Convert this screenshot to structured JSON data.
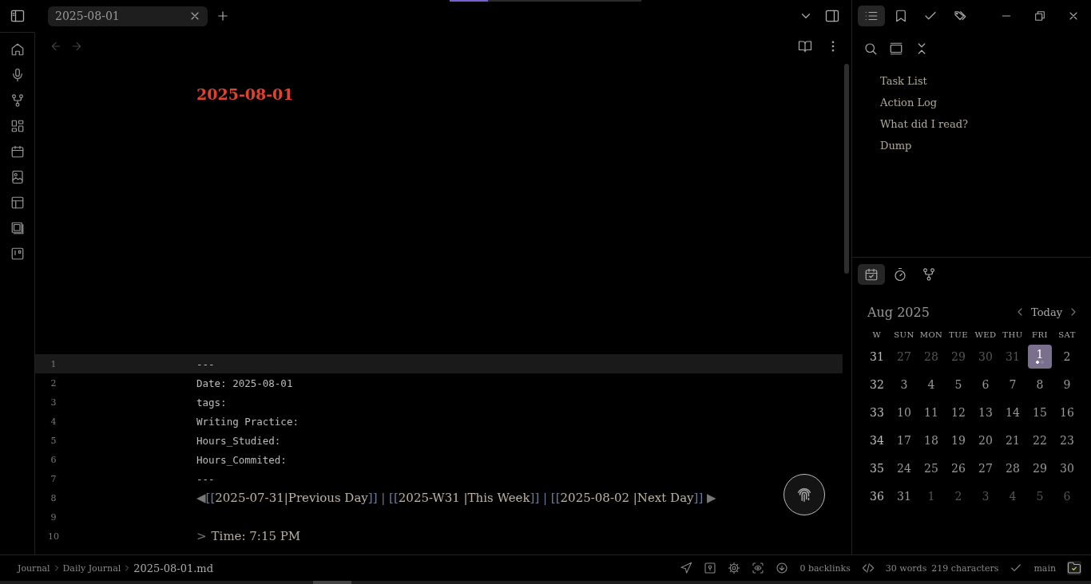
{
  "top_progress": {
    "level": 0.2
  },
  "tabs": [
    {
      "label": "2025-08-01",
      "selected": true
    }
  ],
  "note": {
    "title": "2025-08-01",
    "lines": [
      {
        "number": "1",
        "kind": "mono",
        "active": true,
        "text": "---"
      },
      {
        "number": "2",
        "kind": "mono",
        "active": false,
        "text": "Date: 2025-08-01"
      },
      {
        "number": "3",
        "kind": "mono",
        "active": false,
        "text": "tags:"
      },
      {
        "number": "4",
        "kind": "mono",
        "active": false,
        "text": "Writing Practice:"
      },
      {
        "number": "5",
        "kind": "mono",
        "active": false,
        "text": "Hours_Studied:"
      },
      {
        "number": "6",
        "kind": "mono",
        "active": false,
        "text": "Hours_Commited:"
      },
      {
        "number": "7",
        "kind": "mono",
        "active": false,
        "text": "---"
      },
      {
        "number": "8",
        "kind": "nav",
        "active": false,
        "segments": [
          {
            "kind": "arrow",
            "text": "◀"
          },
          {
            "kind": "punct",
            "text": "[["
          },
          {
            "kind": "link",
            "text": "2025-07-31|Previous Day"
          },
          {
            "kind": "punct",
            "text": "]] | [["
          },
          {
            "kind": "link",
            "text": "2025-W31 |This Week"
          },
          {
            "kind": "punct",
            "text": "]] | [["
          },
          {
            "kind": "link",
            "text": "2025-08-02 |Next Day"
          },
          {
            "kind": "punct",
            "text": "]]"
          },
          {
            "kind": "arrow",
            "text": "▶"
          }
        ]
      },
      {
        "number": "9",
        "kind": "blank",
        "active": false
      },
      {
        "number": "10",
        "kind": "quote",
        "active": false,
        "marker": ">",
        "text": "Time: 7:15 PM"
      }
    ]
  },
  "sidebar_tabs": [
    {
      "kind": "outline",
      "selected": true
    },
    {
      "kind": "bookmarks",
      "selected": false
    },
    {
      "kind": "tasks",
      "selected": false
    },
    {
      "kind": "tags",
      "selected": false
    }
  ],
  "outline": {
    "items": [
      "Task List",
      "Action Log",
      "What did I read?",
      "Dump"
    ]
  },
  "calendar_tabs": [
    {
      "kind": "calendar",
      "selected": true
    },
    {
      "kind": "timer",
      "selected": false
    },
    {
      "kind": "graph",
      "selected": false
    }
  ],
  "calendar": {
    "month": "Aug 2025",
    "today": "Today",
    "headers": [
      "W",
      "SUN",
      "MON",
      "TUE",
      "WED",
      "THU",
      "FRI",
      "SAT"
    ],
    "weeks": [
      {
        "week": "31",
        "days": [
          {
            "label": "27",
            "outside": true,
            "selected": false
          },
          {
            "label": "28",
            "outside": true,
            "selected": false
          },
          {
            "label": "29",
            "outside": true,
            "selected": false
          },
          {
            "label": "30",
            "outside": true,
            "selected": false
          },
          {
            "label": "31",
            "outside": true,
            "selected": false
          },
          {
            "label": "1",
            "outside": false,
            "selected": true,
            "dots": [
              {
                "filled": true
              },
              {
                "filled": false
              }
            ]
          },
          {
            "label": "2",
            "outside": false,
            "selected": false
          }
        ]
      },
      {
        "week": "32",
        "days": [
          {
            "label": "3",
            "outside": false,
            "selected": false
          },
          {
            "label": "4",
            "outside": false,
            "selected": false
          },
          {
            "label": "5",
            "outside": false,
            "selected": false
          },
          {
            "label": "6",
            "outside": false,
            "selected": false
          },
          {
            "label": "7",
            "outside": false,
            "selected": false
          },
          {
            "label": "8",
            "outside": false,
            "selected": false
          },
          {
            "label": "9",
            "outside": false,
            "selected": false
          }
        ]
      },
      {
        "week": "33",
        "days": [
          {
            "label": "10",
            "outside": false,
            "selected": false
          },
          {
            "label": "11",
            "outside": false,
            "selected": false
          },
          {
            "label": "12",
            "outside": false,
            "selected": false
          },
          {
            "label": "13",
            "outside": false,
            "selected": false
          },
          {
            "label": "14",
            "outside": false,
            "selected": false
          },
          {
            "label": "15",
            "outside": false,
            "selected": false
          },
          {
            "label": "16",
            "outside": false,
            "selected": false
          }
        ]
      },
      {
        "week": "34",
        "days": [
          {
            "label": "17",
            "outside": false,
            "selected": false
          },
          {
            "label": "18",
            "outside": false,
            "selected": false
          },
          {
            "label": "19",
            "outside": false,
            "selected": false
          },
          {
            "label": "20",
            "outside": false,
            "selected": false
          },
          {
            "label": "21",
            "outside": false,
            "selected": false
          },
          {
            "label": "22",
            "outside": false,
            "selected": false
          },
          {
            "label": "23",
            "outside": false,
            "selected": false
          }
        ]
      },
      {
        "week": "35",
        "days": [
          {
            "label": "24",
            "outside": false,
            "selected": false
          },
          {
            "label": "25",
            "outside": false,
            "selected": false
          },
          {
            "label": "26",
            "outside": false,
            "selected": false
          },
          {
            "label": "27",
            "outside": false,
            "selected": false
          },
          {
            "label": "28",
            "outside": false,
            "selected": false
          },
          {
            "label": "29",
            "outside": false,
            "selected": false
          },
          {
            "label": "30",
            "outside": false,
            "selected": false
          }
        ]
      },
      {
        "week": "36",
        "days": [
          {
            "label": "31",
            "outside": false,
            "selected": false
          },
          {
            "label": "1",
            "outside": true,
            "selected": false
          },
          {
            "label": "2",
            "outside": true,
            "selected": false
          },
          {
            "label": "3",
            "outside": true,
            "selected": false
          },
          {
            "label": "4",
            "outside": true,
            "selected": false
          },
          {
            "label": "5",
            "outside": true,
            "selected": false
          },
          {
            "label": "6",
            "outside": true,
            "selected": false
          }
        ]
      }
    ]
  },
  "status_bar": {
    "breadcrumb": [
      "Journal",
      "Daily Journal",
      "2025-08-01.md"
    ],
    "backlinks": "0 backlinks",
    "words": "30 words",
    "characters": "219 characters",
    "branch": "main"
  }
}
